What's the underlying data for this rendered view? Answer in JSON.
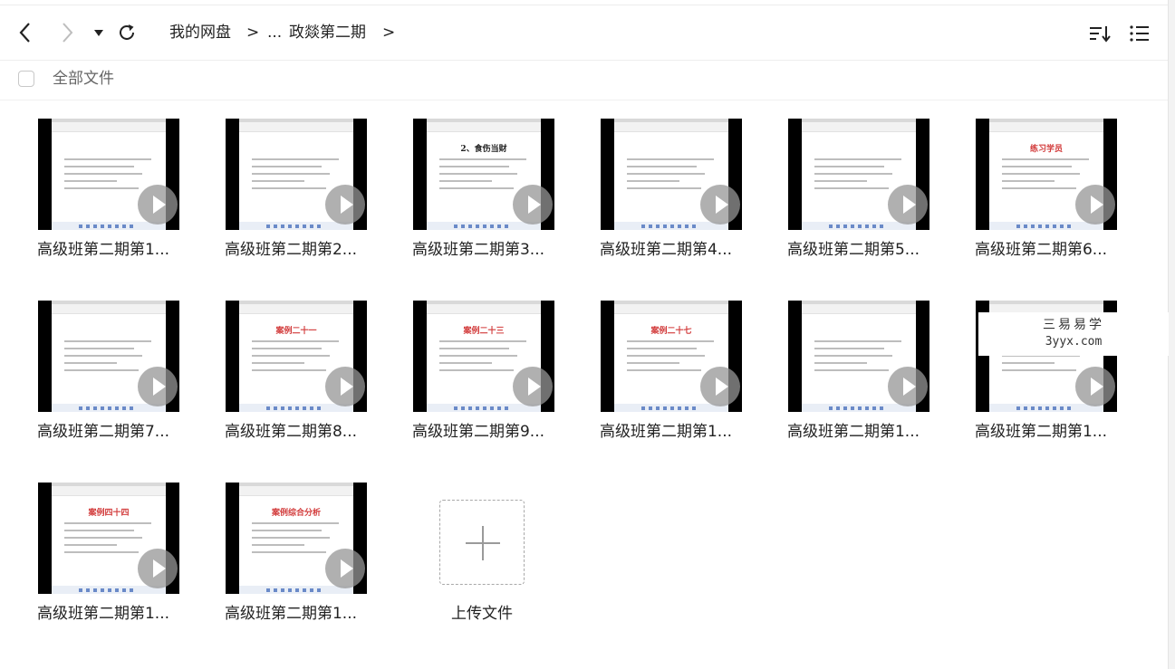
{
  "toolbar": {
    "breadcrumb": {
      "root": "我的网盘",
      "ellipsis": "...",
      "current": "政燚第二期",
      "separator": ">"
    }
  },
  "subbar": {
    "all_files_label": "全部文件"
  },
  "files": [
    {
      "name": "高级班第二期第1...",
      "thumb_title": ""
    },
    {
      "name": "高级班第二期第2...",
      "thumb_title": ""
    },
    {
      "name": "高级班第二期第3...",
      "thumb_title": "2、食伤当财"
    },
    {
      "name": "高级班第二期第4...",
      "thumb_title": ""
    },
    {
      "name": "高级班第二期第5...",
      "thumb_title": ""
    },
    {
      "name": "高级班第二期第6...",
      "thumb_title": "练习学员"
    },
    {
      "name": "高级班第二期第7...",
      "thumb_title": ""
    },
    {
      "name": "高级班第二期第8...",
      "thumb_title": "案例二十一"
    },
    {
      "name": "高级班第二期第9...",
      "thumb_title": "案例二十三"
    },
    {
      "name": "高级班第二期第1...",
      "thumb_title": "案例二十七"
    },
    {
      "name": "高级班第二期第1...",
      "thumb_title": ""
    },
    {
      "name": "高级班第二期第1...",
      "thumb_title": ""
    },
    {
      "name": "高级班第二期第1...",
      "thumb_title": "案例四十四"
    },
    {
      "name": "高级班第二期第1...",
      "thumb_title": "案例综合分析"
    }
  ],
  "upload": {
    "label": "上传文件"
  },
  "watermark": {
    "line1": "三易易学",
    "line2": "3yyx.com"
  },
  "colors": {
    "accent_red": "#d23b3b",
    "play_overlay": "#969696"
  },
  "icons": [
    "back-arrow-icon",
    "forward-arrow-icon",
    "dropdown-caret-icon",
    "refresh-icon",
    "sort-icon",
    "list-view-icon",
    "play-icon",
    "plus-icon"
  ]
}
